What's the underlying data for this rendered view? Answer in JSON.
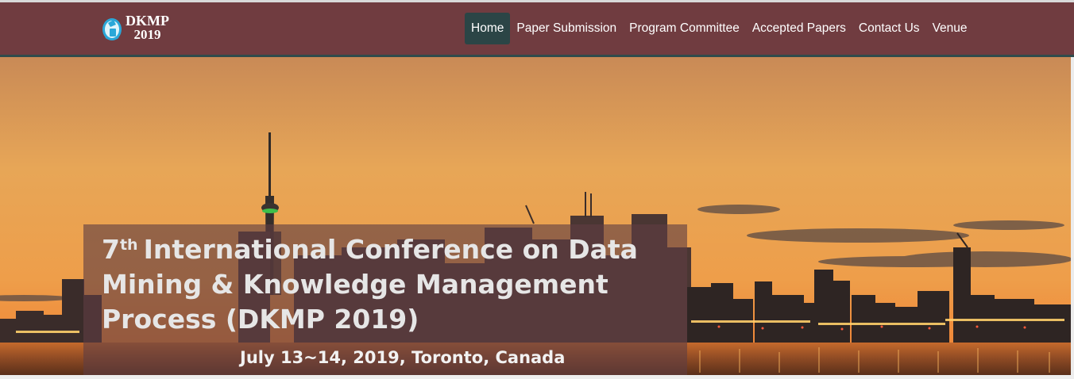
{
  "site": {
    "logo_name": "DKMP",
    "logo_year": "2019"
  },
  "nav": {
    "items": [
      {
        "label": "Home",
        "active": true
      },
      {
        "label": "Paper Submission",
        "active": false
      },
      {
        "label": "Program Committee",
        "active": false
      },
      {
        "label": "Accepted Papers",
        "active": false
      },
      {
        "label": "Contact Us",
        "active": false
      },
      {
        "label": "Venue",
        "active": false
      }
    ]
  },
  "hero": {
    "title_ordinal": "7",
    "title_sup": "th",
    "title_rest": "International Conference on Data Mining & Knowledge Management Process (DKMP 2019)",
    "subtitle": "July 13~14, 2019, Toronto, Canada"
  },
  "colors": {
    "navbar": "#703c40",
    "nav_active": "#2b4546",
    "title_box": "rgba(96,62,66,0.62)"
  }
}
